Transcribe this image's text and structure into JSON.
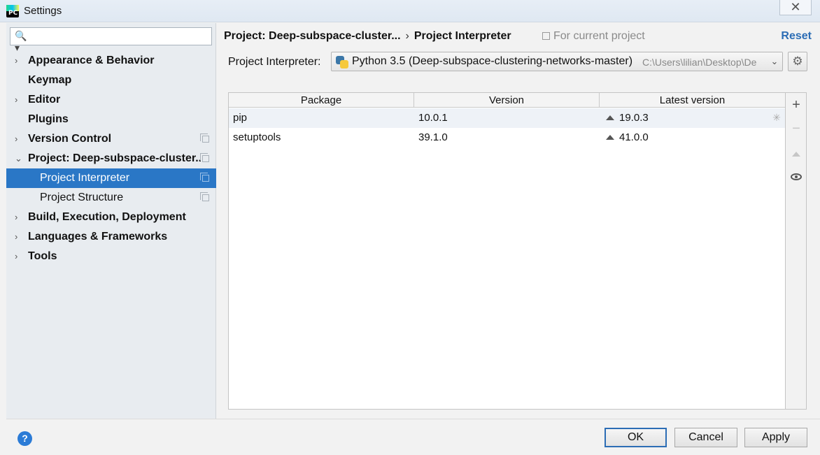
{
  "window": {
    "title": "Settings",
    "close_glyph": "✕"
  },
  "sidebar": {
    "search_placeholder": "",
    "search_value": "",
    "items": [
      {
        "label": "Appearance & Behavior",
        "arrow": "›",
        "copy": false,
        "child": false,
        "selected": false
      },
      {
        "label": "Keymap",
        "arrow": "",
        "copy": false,
        "child": false,
        "selected": false
      },
      {
        "label": "Editor",
        "arrow": "›",
        "copy": false,
        "child": false,
        "selected": false
      },
      {
        "label": "Plugins",
        "arrow": "",
        "copy": false,
        "child": false,
        "selected": false
      },
      {
        "label": "Version Control",
        "arrow": "›",
        "copy": true,
        "child": false,
        "selected": false
      },
      {
        "label": "Project: Deep-subspace-cluster..",
        "arrow": "⌄",
        "copy": true,
        "child": false,
        "selected": false
      },
      {
        "label": "Project Interpreter",
        "arrow": "",
        "copy": true,
        "child": true,
        "selected": true
      },
      {
        "label": "Project Structure",
        "arrow": "",
        "copy": true,
        "child": true,
        "selected": false
      },
      {
        "label": "Build, Execution, Deployment",
        "arrow": "›",
        "copy": false,
        "child": false,
        "selected": false
      },
      {
        "label": "Languages & Frameworks",
        "arrow": "›",
        "copy": false,
        "child": false,
        "selected": false
      },
      {
        "label": "Tools",
        "arrow": "›",
        "copy": false,
        "child": false,
        "selected": false
      }
    ]
  },
  "main": {
    "breadcrumb": {
      "project": "Project: Deep-subspace-cluster...",
      "separator": "›",
      "page": "Project Interpreter"
    },
    "for_current_project": "For current project",
    "reset": "Reset",
    "interpreter_label": "Project Interpreter:",
    "interpreter_name": "Python 3.5 (Deep-subspace-clustering-networks-master)",
    "interpreter_path": "C:\\Users\\lilian\\Desktop\\De",
    "gear_glyph": "⚙",
    "table": {
      "headers": [
        "Package",
        "Version",
        "Latest version"
      ],
      "rows": [
        {
          "package": "pip",
          "version": "10.0.1",
          "latest": "19.0.3"
        },
        {
          "package": "setuptools",
          "version": "39.1.0",
          "latest": "41.0.0"
        }
      ]
    },
    "tools": {
      "add": "+",
      "remove": "−"
    }
  },
  "footer": {
    "help": "?",
    "ok": "OK",
    "cancel": "Cancel",
    "apply": "Apply"
  }
}
